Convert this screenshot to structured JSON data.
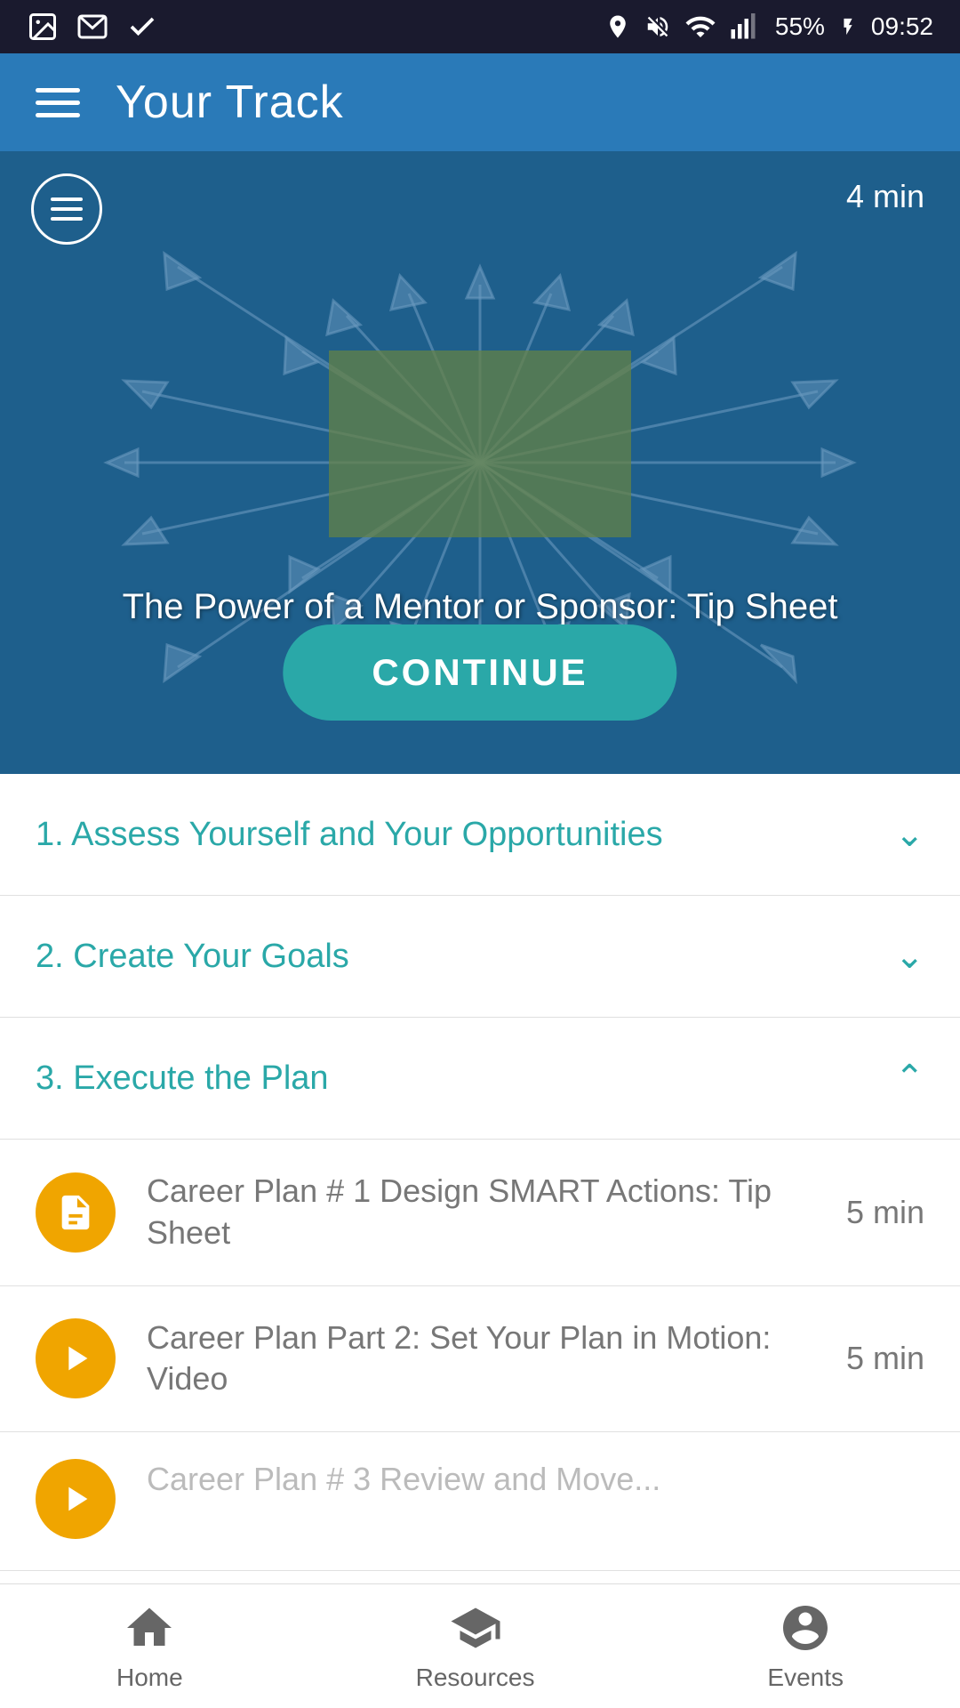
{
  "statusBar": {
    "battery": "55%",
    "time": "09:52"
  },
  "nav": {
    "title": "Your Track",
    "menuIcon": "menu-icon"
  },
  "hero": {
    "duration": "4 min",
    "title": "The Power of a Mentor or Sponsor: Tip Sheet",
    "continueButton": "CONTINUE"
  },
  "accordion": {
    "sections": [
      {
        "label": "1. Assess Yourself and Your Opportunities",
        "expanded": false,
        "chevron": "▾"
      },
      {
        "label": "2. Create Your Goals",
        "expanded": false,
        "chevron": "▾"
      },
      {
        "label": "3. Execute the Plan",
        "expanded": true,
        "chevron": "▴"
      }
    ]
  },
  "trackItems": [
    {
      "id": 1,
      "title": "Career Plan # 1 Design SMART Actions: Tip Sheet",
      "duration": "5 min",
      "iconType": "document"
    },
    {
      "id": 2,
      "title": "Career Plan Part 2: Set Your Plan in Motion: Video",
      "duration": "5 min",
      "iconType": "play"
    },
    {
      "id": 3,
      "title": "Career Plan # 3 Review and Move...",
      "duration": "",
      "iconType": "play"
    }
  ],
  "bottomNav": {
    "items": [
      {
        "label": "Home",
        "icon": "home-icon"
      },
      {
        "label": "Resources",
        "icon": "resources-icon"
      },
      {
        "label": "Events",
        "icon": "events-icon"
      }
    ]
  }
}
